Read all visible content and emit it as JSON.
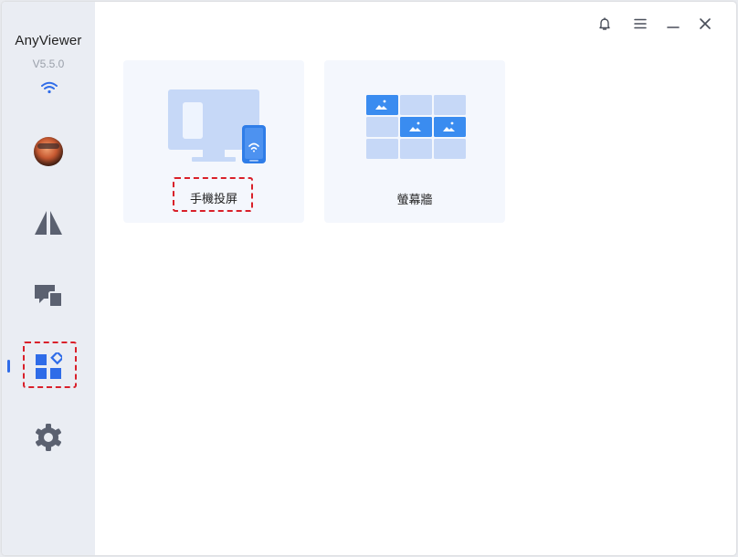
{
  "app": {
    "title": "AnyViewer",
    "version": "V5.5.0",
    "accent_color": "#2f6ce8",
    "highlight_color": "#d9202a"
  },
  "sidebar": {
    "status_icon": "wifi-icon",
    "items": [
      {
        "name": "avatar",
        "icon": "avatar"
      },
      {
        "name": "connect",
        "icon": "connect-icon"
      },
      {
        "name": "devices",
        "icon": "devices-icon"
      },
      {
        "name": "tools",
        "icon": "apps-icon",
        "active": true
      },
      {
        "name": "settings",
        "icon": "gear-icon"
      }
    ]
  },
  "titlebar": {
    "controls": [
      "bell-icon",
      "menu-icon",
      "minimize-icon",
      "close-icon"
    ]
  },
  "main": {
    "cards": [
      {
        "label": "手機投屏",
        "icon": "phone-mirroring-icon",
        "highlighted": true
      },
      {
        "label": "螢幕牆",
        "icon": "screen-wall-icon",
        "highlighted": false
      }
    ]
  }
}
